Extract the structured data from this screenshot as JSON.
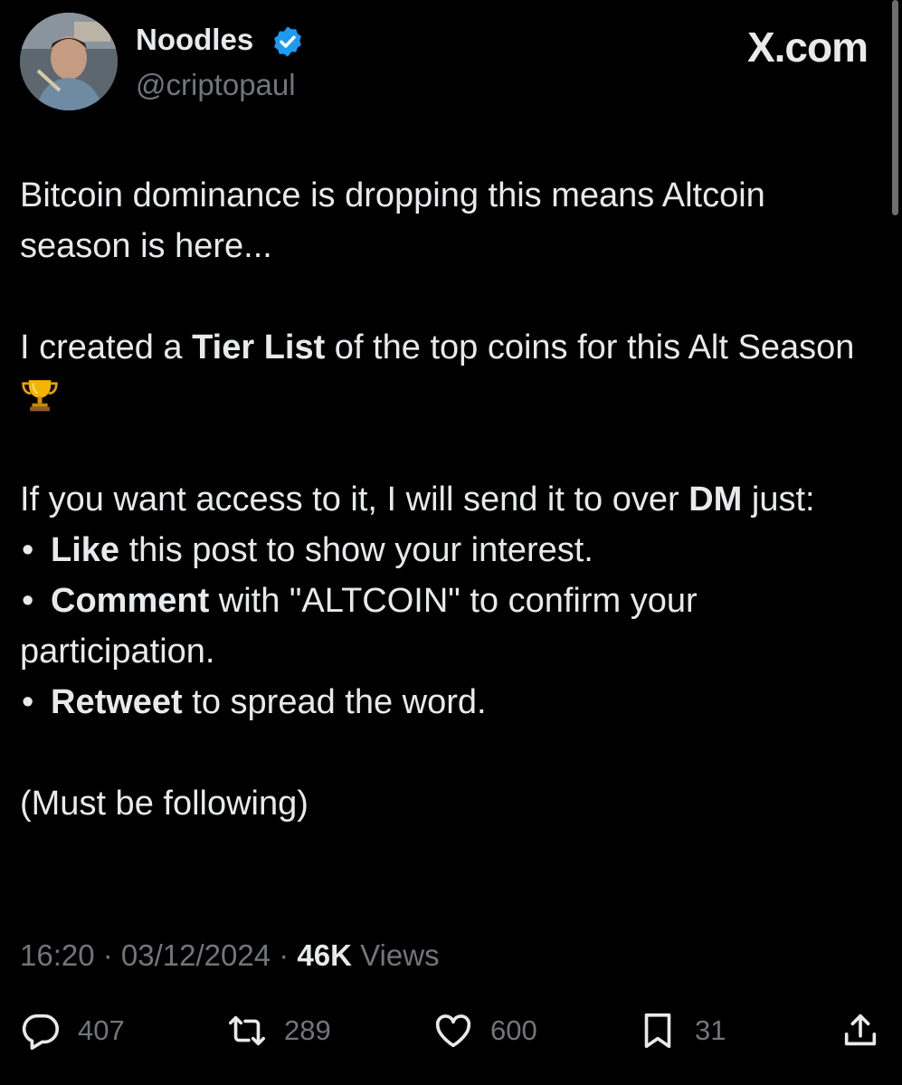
{
  "author": {
    "display_name": "Noodles",
    "handle": "@criptopaul",
    "verified": true,
    "avatar_icon": "profile-photo"
  },
  "site_label": "X.com",
  "post": {
    "line1": "Bitcoin dominance is dropping this means Altcoin season is here...",
    "p2_pre": "I created a ",
    "p2_bold": "Tier List",
    "p2_post": " of the top coins for this Alt Season",
    "p2_emoji_icon": "trophy-icon",
    "p3_pre": "If you want access to it, I will send it to over ",
    "p3_bold": "DM",
    "p3_post": " just:",
    "bullets": [
      {
        "marker": "•",
        "bold": "Like",
        "text": " this post to show your interest."
      },
      {
        "marker": "•",
        "bold": "Comment",
        "text": " with \"ALTCOIN\" to confirm your participation."
      },
      {
        "marker": "•",
        "bold": "Retweet",
        "text": " to spread the word."
      }
    ],
    "closing": "(Must be following)"
  },
  "meta": {
    "time": "16:20",
    "separator": " · ",
    "date": "03/12/2024",
    "views_count": "46K",
    "views_label": " Views"
  },
  "actions": {
    "replies": "407",
    "reposts": "289",
    "likes": "600",
    "bookmarks": "31"
  },
  "colors": {
    "background": "#000000",
    "text_primary": "#e7e9ea",
    "text_secondary": "#71767b",
    "verified_blue": "#1d9bf0"
  }
}
